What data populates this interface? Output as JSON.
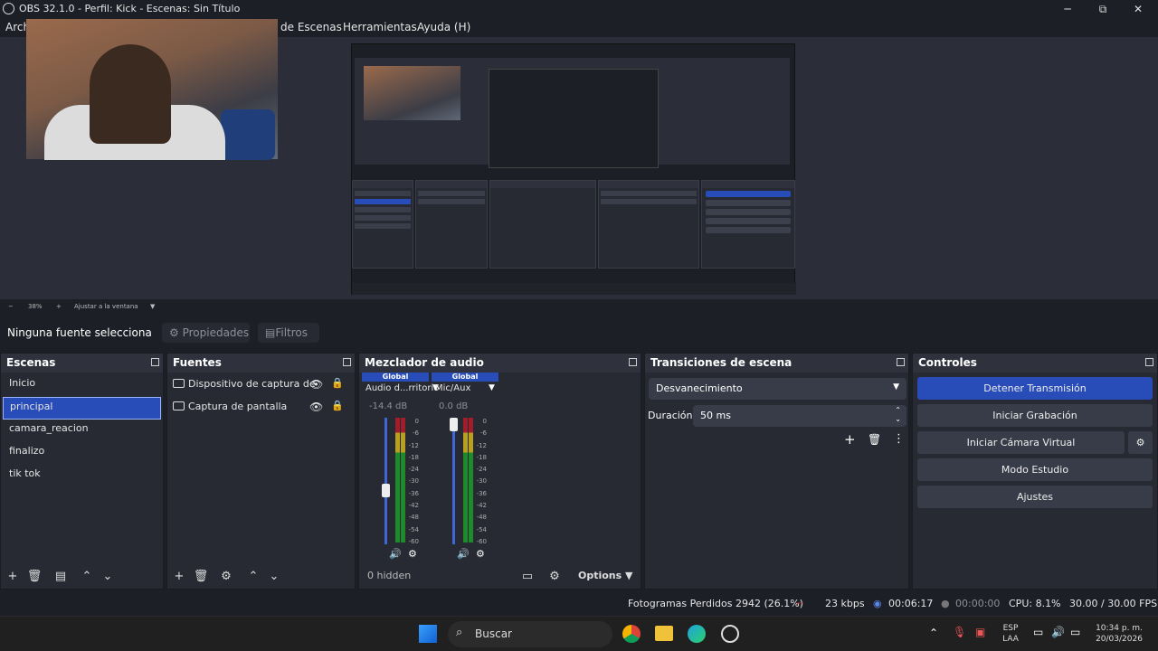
{
  "window": {
    "title": "OBS 32.1.0 - Perfil: Kick - Escenas: Sin Título",
    "min": "─",
    "max": "⧉",
    "close": "✕"
  },
  "menu": {
    "items": [
      "Arch",
      "de Escenas",
      "Herramientas",
      "Ayuda (H)"
    ]
  },
  "zoom": {
    "minus": "−",
    "value": "38%",
    "plus": "+",
    "fit": "Ajustar a la ventana",
    "arrow": "▼"
  },
  "toolbar": {
    "no_source": "Ninguna fuente selecciona",
    "properties": "Propiedades",
    "filters": "Filtros"
  },
  "scenes": {
    "title": "Escenas",
    "items": [
      "Inicio",
      "principal",
      "camara_reacion",
      "finalizo",
      "tik tok"
    ]
  },
  "sources": {
    "title": "Fuentes",
    "items": [
      "Dispositivo de captura de",
      "Captura de pantalla"
    ]
  },
  "mixer": {
    "title": "Mezclador de audio",
    "channels": [
      {
        "global": "Global",
        "name": "Audio d...rritorio",
        "db": "-14.4 dB"
      },
      {
        "global": "Global",
        "name": "Mic/Aux",
        "db": "0.0 dB"
      }
    ],
    "scale": [
      "0",
      "-6",
      "-12",
      "-18",
      "-24",
      "-30",
      "-36",
      "-42",
      "-48",
      "-54",
      "-60"
    ],
    "hidden": "0 hidden",
    "options": "Options"
  },
  "transitions": {
    "title": "Transiciones de escena",
    "selected": "Desvanecimiento",
    "duration_label": "Duración",
    "duration_value": "50 ms"
  },
  "controls": {
    "title": "Controles",
    "stop_stream": "Detener Transmisión",
    "start_rec": "Iniciar Grabación",
    "virtual_cam": "Iniciar Cámara Virtual",
    "studio": "Modo Estudio",
    "settings": "Ajustes"
  },
  "status": {
    "dropped": "Fotogramas Perdidos 2942 (26.1%)",
    "kbps": "23 kbps",
    "stream_time": "00:06:17",
    "rec_time": "00:00:00",
    "cpu": "CPU: 8.1%",
    "fps": "30.00 / 30.00 FPS"
  },
  "taskbar": {
    "search": "Buscar",
    "lang1": "ESP",
    "lang2": "LAA",
    "time": "10:34 p. m.",
    "date": "20/03/2026"
  },
  "colors": {
    "accent": "#284cb8",
    "dock_bg": "#272a33",
    "window_bg": "#1d1f26"
  }
}
